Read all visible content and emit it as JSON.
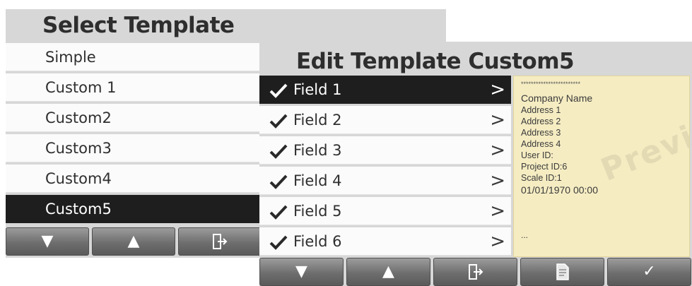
{
  "back_screen": {
    "title": "Select Template",
    "items": [
      {
        "label": "Simple",
        "selected": false
      },
      {
        "label": "Custom 1",
        "selected": false
      },
      {
        "label": "Custom2",
        "selected": false
      },
      {
        "label": "Custom3",
        "selected": false
      },
      {
        "label": "Custom4",
        "selected": false
      },
      {
        "label": "Custom5",
        "selected": true
      }
    ],
    "softkeys": [
      {
        "icon": "arrow-down-icon",
        "glyph": "▼"
      },
      {
        "icon": "arrow-up-icon",
        "glyph": "▲"
      },
      {
        "icon": "exit-icon",
        "glyph": ""
      }
    ]
  },
  "front_screen": {
    "title": "Edit Template Custom5",
    "fields": [
      {
        "label": "Field 1",
        "checked": true,
        "selected": true,
        "chevron": ">"
      },
      {
        "label": "Field 2",
        "checked": true,
        "selected": false,
        "chevron": ">"
      },
      {
        "label": "Field 3",
        "checked": true,
        "selected": false,
        "chevron": ">"
      },
      {
        "label": "Field 4",
        "checked": true,
        "selected": false,
        "chevron": ">"
      },
      {
        "label": "Field 5",
        "checked": true,
        "selected": false,
        "chevron": ">"
      },
      {
        "label": "Field 6",
        "checked": true,
        "selected": false,
        "chevron": ">"
      }
    ],
    "preview": {
      "stars": "************************",
      "lines": [
        "Company Name",
        "Address 1",
        "Address 2",
        "Address 3",
        "Address 4",
        "User ID:",
        "Project ID:6",
        "Scale ID:1",
        "01/01/1970   00:00"
      ],
      "ellipsis": "...",
      "watermark": "Preview",
      "background_color": "#f5ecc2"
    },
    "softkeys": [
      {
        "icon": "arrow-down-icon",
        "glyph": "▼"
      },
      {
        "icon": "arrow-up-icon",
        "glyph": "▲"
      },
      {
        "icon": "exit-icon",
        "glyph": ""
      },
      {
        "icon": "document-icon",
        "glyph": ""
      },
      {
        "icon": "checkmark-icon",
        "glyph": "✓"
      }
    ]
  },
  "colors": {
    "selected_row": "#1e1e1e",
    "screen_background": "#d7d7d7",
    "row_background": "#fbfbfb"
  }
}
